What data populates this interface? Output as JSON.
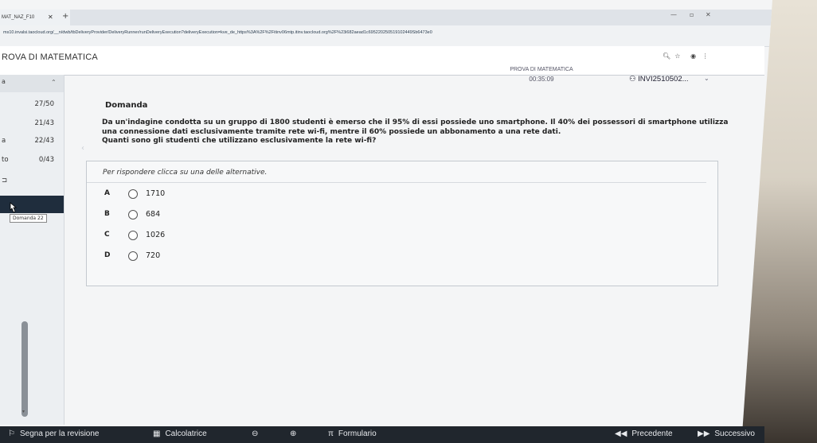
{
  "browser": {
    "tab_title": "MAT_NAZ_F10",
    "url": "ms10.invalsi.taocloud.org/__n/dwb/tbDeliveryProvider/DeliveryRunner/runDeliveryExecution?deliveryExecution=kve_de_https%3A%2F%2Fitinv06mtp.itinv.taocloud.org%2F%23i682aead1c695220250519102449Sb6473e0"
  },
  "header": {
    "app_title": "ROVA DI MATEMATICA",
    "test_name": "PROVA DI MATEMATICA",
    "timer": "00:35:09",
    "user": "INVI2510502..."
  },
  "sidebar": {
    "head_label": "a",
    "rows": [
      {
        "letter": "",
        "count": "27/50"
      },
      {
        "letter": "",
        "count": "21/43"
      },
      {
        "letter": "a",
        "count": "22/43"
      },
      {
        "letter": "to",
        "count": "0/43"
      }
    ],
    "tooltip": "Domanda 22"
  },
  "question": {
    "label": "Domanda",
    "line1": "Da un'indagine condotta su un gruppo di 1800 studenti è emerso che il 95% di essi possiede uno smartphone. Il 40% dei possessori di smartphone utilizza",
    "line2": "una connessione dati esclusivamente tramite rete wi-fi, mentre il 60% possiede un abbonamento a una rete dati.",
    "line3": "Quanti sono gli studenti che utilizzano esclusivamente la rete wi-fi?",
    "instruction": "Per rispondere clicca su una delle alternative.",
    "choices": [
      {
        "letter": "A",
        "value": "1710"
      },
      {
        "letter": "B",
        "value": "684"
      },
      {
        "letter": "C",
        "value": "1026"
      },
      {
        "letter": "D",
        "value": "720"
      }
    ]
  },
  "toolbar": {
    "review": "Segna per la revisione",
    "calculator": "Calcolatrice",
    "formulary": "Formulario",
    "previous": "Precedente",
    "next": "Successivo"
  },
  "colors": {
    "toolbar_bg": "#20262d",
    "sidebar_selected": "#1f2d3d"
  }
}
